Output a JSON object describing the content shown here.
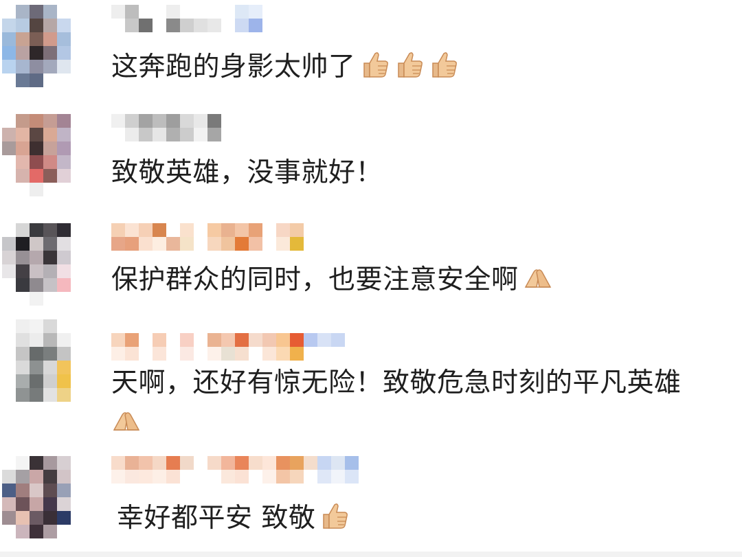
{
  "comments": [
    {
      "text": "这奔跑的身影太帅了",
      "emojis": [
        "thumbs-up",
        "thumbs-up",
        "thumbs-up"
      ],
      "avatar": [
        "#fff",
        "#a9b5c7",
        "#6d6a78",
        "#a9b5c7",
        "#fff",
        "#fff",
        "#c4d6ea",
        "#b7cbe2",
        "#544541",
        "#b6a7a6",
        "#c9d8ee",
        "#fff",
        "#9ab9db",
        "#c8a393",
        "#7b5e55",
        "#d19b8c",
        "#a6bedc",
        "#fff",
        "#8db7e6",
        "#b9a2a2",
        "#2e2729",
        "#7d6f78",
        "#b3c7e4",
        "#fff",
        "#b9d3ef",
        "#a7b6cf",
        "#8e8ea1",
        "#a3a9bc",
        "#dfe6ef",
        "#fff",
        "#fff",
        "#6a7a95",
        "#5f6b85",
        "#fff",
        "#fff",
        "#fff"
      ],
      "name": [
        "#eeeeee",
        "#ffffff",
        "#bdbdbd",
        "#c8c8c8",
        "#ffffff",
        "#707070",
        "#ffffff",
        "#ffffff",
        "#eeeeee",
        "#8a8a8a",
        "#ffffff",
        "#cfcfcf",
        "#ffffff",
        "#e0e0e0",
        "#ffffff",
        "#e8e8e8",
        "#ffffff",
        "#ffffff",
        "#dde8f6",
        "#cddaf3",
        "#e6eefa",
        "#9db4ea"
      ]
    },
    {
      "text": "致敬英雄，没事就好！",
      "emojis": [],
      "avatar": [
        "#fff",
        "#c49b8b",
        "#c48c78",
        "#c59d94",
        "#a38494",
        "#fff",
        "#cdb2ad",
        "#e2b5a4",
        "#5b4743",
        "#d9a995",
        "#c0b4c6",
        "#fff",
        "#a99b9b",
        "#d8a493",
        "#3e2f30",
        "#c7a29a",
        "#b09ab3",
        "#fff",
        "#fff",
        "#e2b7ad",
        "#8f4d4f",
        "#d08a86",
        "#c3b7c8",
        "#fff",
        "#fff",
        "#d6b3ad",
        "#e36a67",
        "#8b5e5a",
        "#e1d0d7",
        "#fff",
        "#fff",
        "#fff",
        "#eee",
        "#fff",
        "#fff",
        "#fff"
      ],
      "name": [
        "#f0f0f0",
        "#ffffff",
        "#cfcfcf",
        "#ececec",
        "#a3a3a3",
        "#c8c8c8",
        "#bdbdbd",
        "#e6e6e6",
        "#9e9e9e",
        "#b0b0b0",
        "#d9d9d9",
        "#cccccc",
        "#e8e8e8",
        "#f2f2f2",
        "#7a7a7a",
        "#a6a6a6",
        "#ffffff",
        "#ffffff"
      ]
    },
    {
      "text": "保护群众的同时，也要注意安全啊",
      "emojis": [
        "pray"
      ],
      "avatar": [
        "#fff",
        "#d6d6d6",
        "#3b3b3f",
        "#585458",
        "#2f2c33",
        "#fff",
        "#c6c6c9",
        "#1f1e22",
        "#cfc7c7",
        "#6d6b70",
        "#e2dfe2",
        "#fff",
        "#d8d3d5",
        "#979095",
        "#b5a8ad",
        "#3a3539",
        "#cfcad0",
        "#fff",
        "#e8e6e8",
        "#444045",
        "#c9c0c4",
        "#b4b0b5",
        "#f1dfe4",
        "#fff",
        "#fff",
        "#3a3a3f",
        "#8f8a8f",
        "#c6c2c6",
        "#f5b8be",
        "#fff",
        "#fff",
        "#fff",
        "#f2f2f2",
        "#fff",
        "#fff",
        "#fff"
      ],
      "name": [
        "#f5d0b4",
        "#e7a688",
        "#fbe3d3",
        "#e7a07c",
        "#f6d0b6",
        "#fae0cf",
        "#d8864f",
        "#fdeee1",
        "#ffffff",
        "#e9b79b",
        "#fae1cd",
        "#f5e3c8",
        "#ffffff",
        "#ffffff",
        "#f6caa3",
        "#f7d7be",
        "#e9b290",
        "#f0c49e",
        "#f3c5a7",
        "#e37a37",
        "#e8a277",
        "#f2c1a6",
        "#ffffff",
        "#ffffff",
        "#f7d7c5",
        "#fbe9da",
        "#f3cba8",
        "#e4b93a"
      ]
    },
    {
      "text": "天啊，还好有惊无险！致敬危急时刻的平凡英雄",
      "emojis": [],
      "text2": "",
      "emojis2": [
        "pray"
      ],
      "avatar": [
        "#fff",
        "#efefef",
        "#f3f3f3",
        "#d9d9d9",
        "#fff",
        "#fff",
        "#fff",
        "#e0e0e0",
        "#ececec",
        "#b8b8b8",
        "#f0f0f0",
        "#fff",
        "#fff",
        "#c5c5c5",
        "#676b6b",
        "#7a7e7e",
        "#c4c4c4",
        "#fff",
        "#fff",
        "#dadada",
        "#8d9191",
        "#d8d8d8",
        "#f2c45b",
        "#fff",
        "#fff",
        "#a9adad",
        "#6a6e6e",
        "#cfcfcf",
        "#f0c24a",
        "#fff",
        "#fff",
        "#8f9393",
        "#777b7b",
        "#e2e2e2",
        "#eed287",
        "#fff"
      ],
      "name": [
        "#f7d5bd",
        "#fdefe6",
        "#e9a277",
        "#fbe3d5",
        "#ffffff",
        "#ffffff",
        "#f6cdb5",
        "#fbe5d9",
        "#ffffff",
        "#ffffff",
        "#f8d0c4",
        "#fbe9e3",
        "#ffffff",
        "#ffffff",
        "#eab392",
        "#fdf1ea",
        "#f4c8b0",
        "#e8e1d4",
        "#e36f43",
        "#f6dfcf",
        "#f5dbcc",
        "#ffffff",
        "#f2c8b2",
        "#fbe6d8",
        "#f8c691",
        "#fbd9b3",
        "#e65c33",
        "#f0b14c",
        "#b8c9f0",
        "#ffffff",
        "#d8e2f6",
        "#ffffff",
        "#c9d7f3",
        "#ffffff"
      ]
    },
    {
      "text": "幸好都平安 致敬",
      "emojis": [
        "thumbs-up"
      ],
      "avatar": [
        "#fff",
        "#f4f4f4",
        "#3a3236",
        "#a7999e",
        "#d7cfd2",
        "#fff",
        "#dbdbdb",
        "#a5a0a4",
        "#caa7a7",
        "#453c40",
        "#d2c4c7",
        "#fff",
        "#4d5f86",
        "#a07e7e",
        "#d9c7c7",
        "#5e4c51",
        "#98a0b6",
        "#fff",
        "#d4b9b9",
        "#6d5359",
        "#c7a6a6",
        "#45384b",
        "#dbd3d6",
        "#fff",
        "#9e8d92",
        "#e7c1b2",
        "#6b5a63",
        "#3a2f37",
        "#2c3b66",
        "#fff",
        "#fff",
        "#cbb5bc",
        "#3e3039",
        "#ad9da3",
        "#fff",
        "#fff"
      ],
      "name": [
        "#f8dccb",
        "#fdf1ea",
        "#e9b296",
        "#fbe8df",
        "#f2c3ab",
        "#fde9de",
        "#f5d8c6",
        "#fdefe6",
        "#e67d51",
        "#fbe2d5",
        "#f1d9c9",
        "#fff",
        "#ffffff",
        "#ffffff",
        "#f6dac9",
        "#fff",
        "#f2b69b",
        "#fbe8dc",
        "#e9855a",
        "#fbe2d5",
        "#f7ddcc",
        "#ffffff",
        "#fde6d9",
        "#fdf1ea",
        "#e8925f",
        "#f3c5a6",
        "#e8a35e",
        "#f6d6bc",
        "#f4ddcc",
        "#fff",
        "#c7d6f3",
        "#dfe7f7",
        "#dde6f3",
        "#f1f4fa",
        "#a6bfea",
        "#dbe5f7"
      ]
    }
  ]
}
